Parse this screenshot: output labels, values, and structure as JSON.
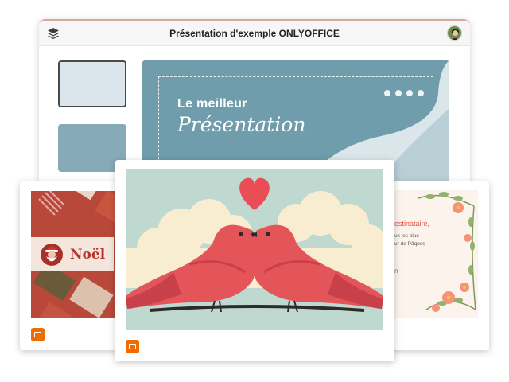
{
  "window": {
    "title": "Présentation d'exemple ONLYOFFICE",
    "icons": {
      "left": "layers-icon",
      "right": "user-avatar"
    }
  },
  "editor": {
    "slide": {
      "heading": "Le meilleur",
      "subheading": "Présentation"
    },
    "thumbnails": [
      "slide-thumbnail-1",
      "slide-thumbnail-2"
    ]
  },
  "templates": {
    "left": {
      "title": "Noël"
    },
    "right": {
      "lines": [
        "estinataire,",
        "ux les plus",
        "ur de Pâques",
        "n"
      ]
    }
  },
  "colors": {
    "slide_bg": "#6f9dab",
    "accent": "#ef6c00",
    "noel_red": "#b84b3a",
    "bird_red": "#e35558"
  }
}
